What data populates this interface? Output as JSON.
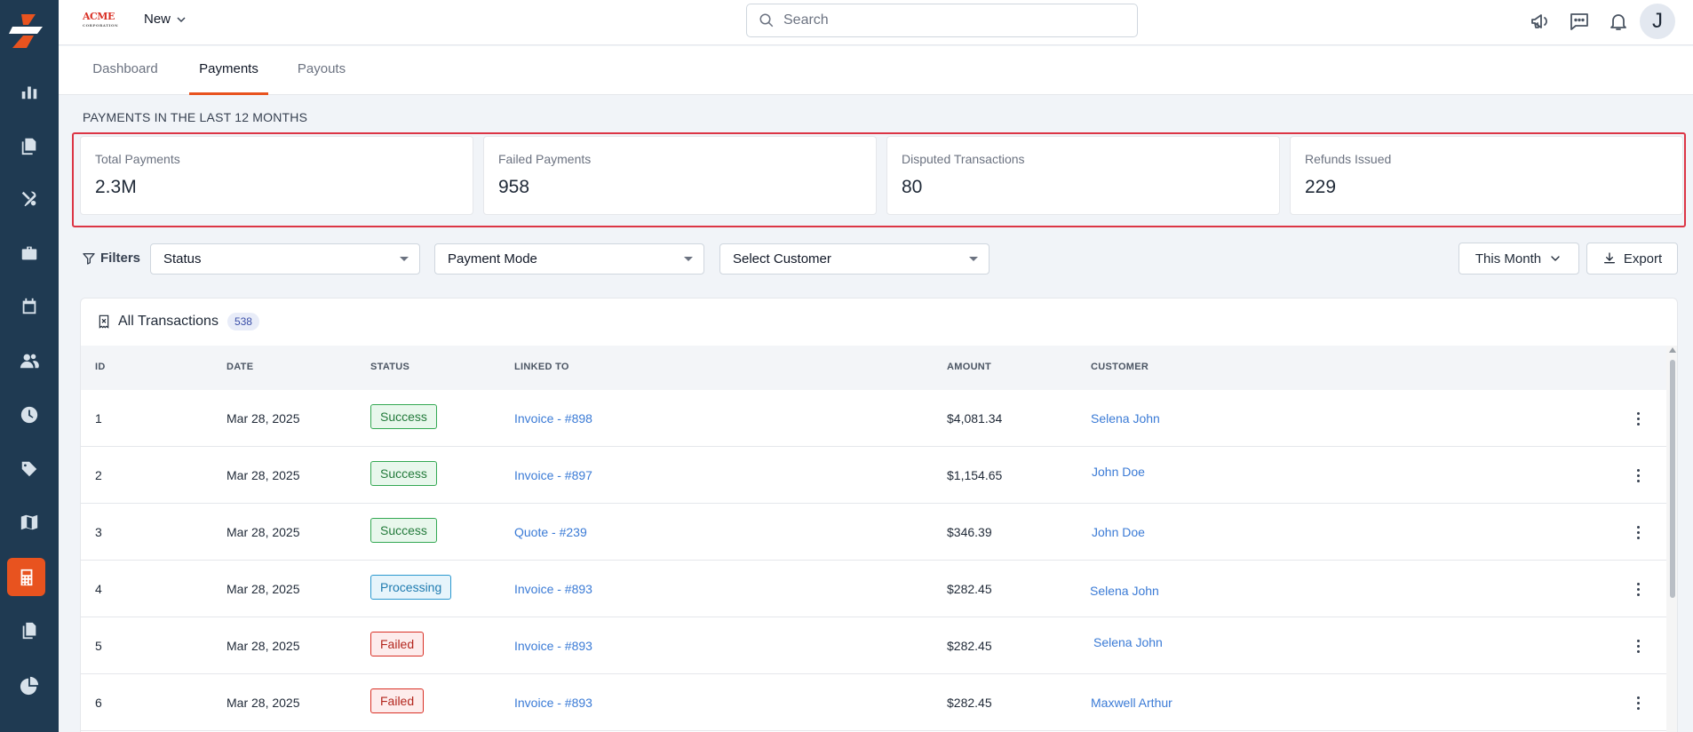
{
  "brand": {
    "logo_text": "ACME",
    "logo_sub": "CORPORATION"
  },
  "header": {
    "new_label": "New",
    "search_placeholder": "Search",
    "avatar_initial": "J"
  },
  "tabs": [
    {
      "label": "Dashboard",
      "active": false
    },
    {
      "label": "Payments",
      "active": true
    },
    {
      "label": "Payouts",
      "active": false
    }
  ],
  "summary": {
    "title": "PAYMENTS IN THE LAST 12 MONTHS",
    "cards": [
      {
        "label": "Total Payments",
        "value": "2.3M"
      },
      {
        "label": "Failed Payments",
        "value": "958"
      },
      {
        "label": "Disputed Transactions",
        "value": "80"
      },
      {
        "label": "Refunds Issued",
        "value": "229"
      }
    ]
  },
  "filters": {
    "label": "Filters",
    "status": "Status",
    "payment_mode": "Payment Mode",
    "customer": "Select Customer",
    "period": "This Month",
    "export": "Export"
  },
  "transactions": {
    "title": "All Transactions",
    "count": "538",
    "columns": [
      "ID",
      "DATE",
      "STATUS",
      "LINKED TO",
      "AMOUNT",
      "CUSTOMER"
    ],
    "rows": [
      {
        "id": "1",
        "date": "Mar 28, 2025",
        "status": "Success",
        "linked": "Invoice - #898",
        "amount": "$4,081.34",
        "customer": "Selena John"
      },
      {
        "id": "2",
        "date": "Mar 28, 2025",
        "status": "Success",
        "linked": "Invoice - #897",
        "amount": "$1,154.65",
        "customer": "John Doe"
      },
      {
        "id": "3",
        "date": "Mar 28, 2025",
        "status": "Success",
        "linked": "Quote - #239",
        "amount": "$346.39",
        "customer": "John Doe"
      },
      {
        "id": "4",
        "date": "Mar 28, 2025",
        "status": "Processing",
        "linked": "Invoice - #893",
        "amount": "$282.45",
        "customer": "Selena John"
      },
      {
        "id": "5",
        "date": "Mar 28, 2025",
        "status": "Failed",
        "linked": "Invoice - #893",
        "amount": "$282.45",
        "customer": "Selena John"
      },
      {
        "id": "6",
        "date": "Mar 28, 2025",
        "status": "Failed",
        "linked": "Invoice - #893",
        "amount": "$282.45",
        "customer": "Maxwell Arthur"
      }
    ]
  },
  "colors": {
    "accent": "#e8531f",
    "sidebar": "#1f3a52",
    "link": "#3b7bd6",
    "highlight": "#dc3545"
  },
  "sidebar_icons": [
    "reports-icon",
    "documents-icon",
    "tools-icon",
    "briefcase-icon",
    "calendar-icon",
    "people-icon",
    "clock-icon",
    "tag-icon",
    "map-icon",
    "calculator-icon",
    "files-icon",
    "pie-chart-icon"
  ]
}
